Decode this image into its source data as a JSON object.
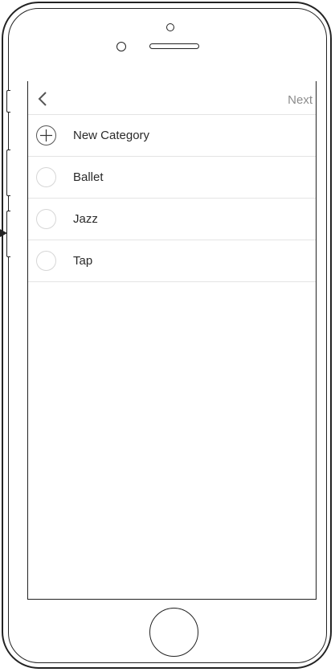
{
  "navbar": {
    "back_icon": "chevron-left-icon",
    "next_label": "Next"
  },
  "list": {
    "new_item": {
      "icon": "plus-icon",
      "label": "New Category"
    },
    "items": [
      {
        "label": "Ballet",
        "selected": false
      },
      {
        "label": "Jazz",
        "selected": false
      },
      {
        "label": "Tap",
        "selected": false
      }
    ]
  },
  "colors": {
    "frame": "#222222",
    "divider": "#e4e4e4",
    "muted_text": "#8c8c8c",
    "text": "#2a2a2a"
  }
}
